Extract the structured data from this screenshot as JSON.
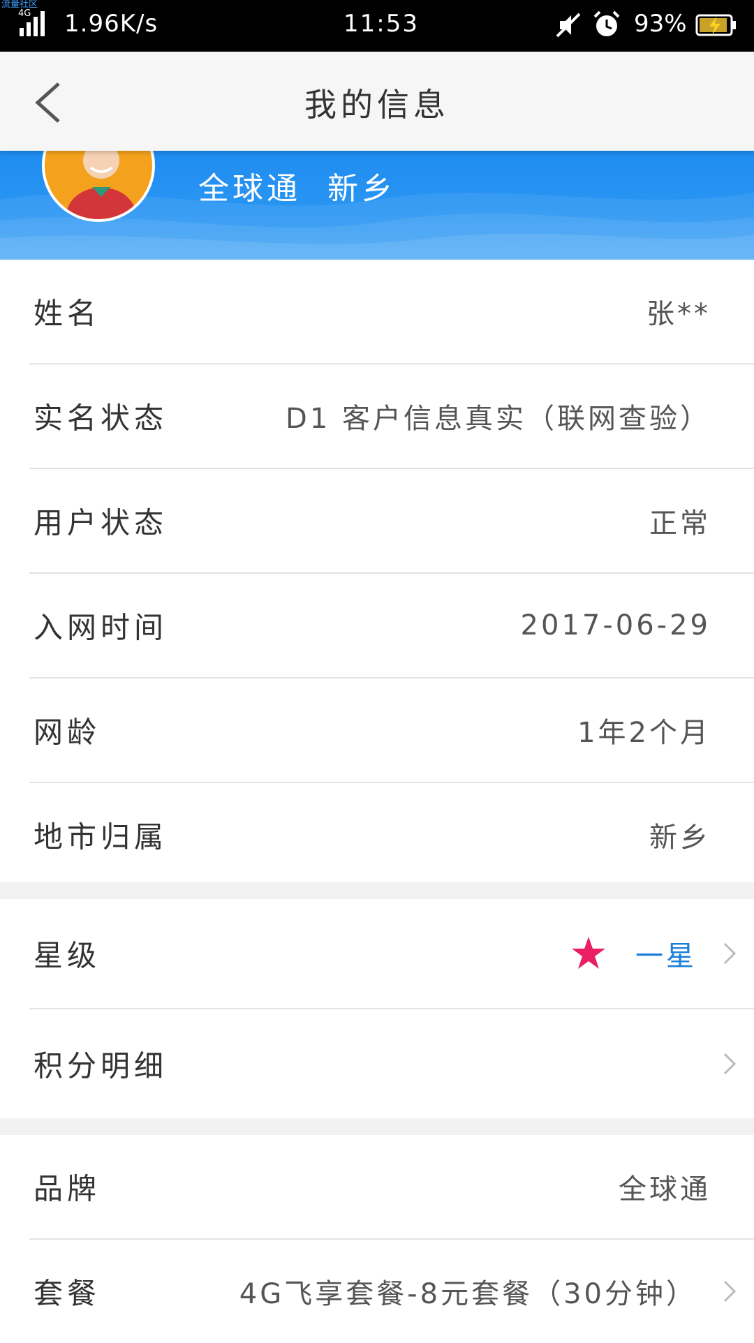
{
  "status_bar": {
    "watermark": "流量社区",
    "network_type": "4G",
    "speed": "1.96K/s",
    "time": "11:53",
    "battery_percent": "93%",
    "battery_level": 0.93
  },
  "header": {
    "title": "我的信息"
  },
  "banner": {
    "brand": "全球通",
    "city": "新乡"
  },
  "info_section": [
    {
      "label": "姓名",
      "value": "张**"
    },
    {
      "label": "实名状态",
      "value": "D1  客户信息真实（联网查验）"
    },
    {
      "label": "用户状态",
      "value": "正常"
    },
    {
      "label": "入网时间",
      "value": "2017-06-29"
    },
    {
      "label": "网龄",
      "value": "1年2个月"
    },
    {
      "label": "地市归属",
      "value": "新乡"
    }
  ],
  "level_section": {
    "star_label": "星级",
    "star_value": "一星",
    "points_label": "积分明细"
  },
  "plan_section": {
    "brand_label": "品牌",
    "brand_value": "全球通",
    "package_label": "套餐",
    "package_value": "4G飞享套餐-8元套餐（30分钟）"
  },
  "colors": {
    "banner_blue": "#2b96f3",
    "star_red": "#e91e63",
    "star_text_blue": "#1a7fd8",
    "avatar_orange": "#f4a21d"
  }
}
